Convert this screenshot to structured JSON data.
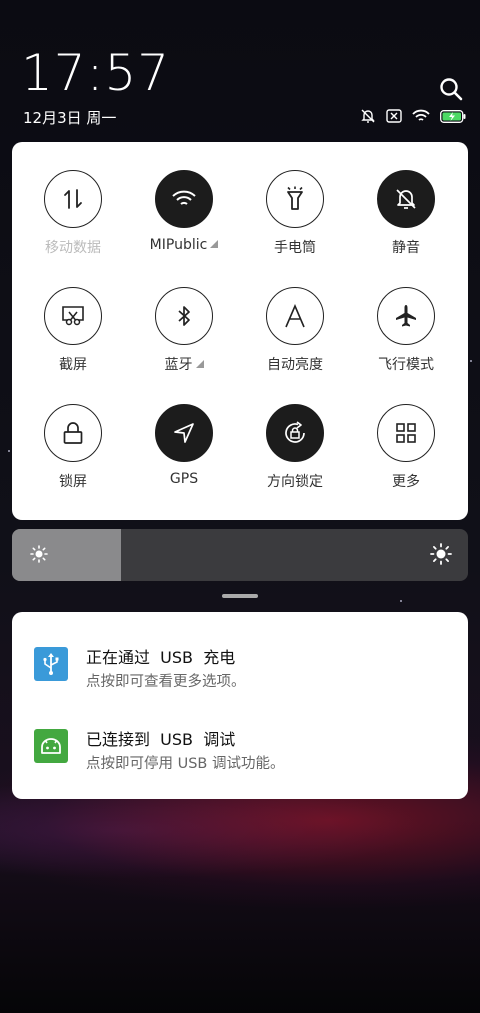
{
  "status_bar": {
    "time": "17:57",
    "date": "12月3日 周一",
    "icons": [
      "bell-muted-icon",
      "sim-disabled-icon",
      "wifi-icon",
      "battery-charging-icon"
    ]
  },
  "quick_settings": {
    "tiles": [
      {
        "label": "移动数据",
        "icon": "mobile-data-icon",
        "on": false,
        "dim": true,
        "expand": false
      },
      {
        "label": "MIPublic",
        "icon": "wifi-icon",
        "on": true,
        "dim": false,
        "expand": true
      },
      {
        "label": "手电筒",
        "icon": "flashlight-icon",
        "on": false,
        "dim": false,
        "expand": false
      },
      {
        "label": "静音",
        "icon": "mute-bell-icon",
        "on": true,
        "dim": false,
        "expand": false
      },
      {
        "label": "截屏",
        "icon": "screenshot-icon",
        "on": false,
        "dim": false,
        "expand": false
      },
      {
        "label": "蓝牙",
        "icon": "bluetooth-icon",
        "on": false,
        "dim": false,
        "expand": true
      },
      {
        "label": "自动亮度",
        "icon": "auto-brightness-icon",
        "on": false,
        "dim": false,
        "expand": false
      },
      {
        "label": "飞行模式",
        "icon": "airplane-icon",
        "on": false,
        "dim": false,
        "expand": false
      },
      {
        "label": "锁屏",
        "icon": "lock-icon",
        "on": false,
        "dim": false,
        "expand": false
      },
      {
        "label": "GPS",
        "icon": "gps-icon",
        "on": true,
        "dim": false,
        "expand": false
      },
      {
        "label": "方向锁定",
        "icon": "rotation-lock-icon",
        "on": true,
        "dim": false,
        "expand": false
      },
      {
        "label": "更多",
        "icon": "grid-icon",
        "on": false,
        "dim": false,
        "expand": false
      }
    ]
  },
  "brightness": {
    "level": 0.24
  },
  "notifications": [
    {
      "title": "正在通过  USB  充电",
      "subtitle": "点按即可查看更多选项。",
      "icon": "usb-icon",
      "color": "#3a9ad9"
    },
    {
      "title": "已连接到  USB  调试",
      "subtitle": "点按即可停用 USB 调试功能。",
      "icon": "android-debug-icon",
      "color": "#43a840"
    }
  ]
}
